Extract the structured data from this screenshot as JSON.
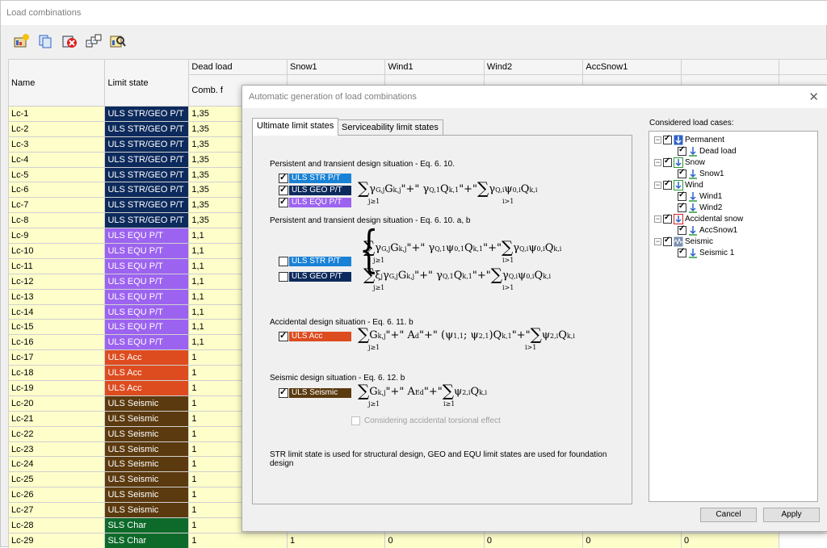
{
  "window": {
    "title": "Load combinations"
  },
  "toolbar": {
    "buttons": [
      "add-combination-icon",
      "copy-icon",
      "delete-icon",
      "generate-icon",
      "find-icon"
    ]
  },
  "table": {
    "headers": {
      "name": "Name",
      "limit_state": "Limit state",
      "dead_load": "Dead load",
      "comb_f": "Comb. f",
      "snow1": "Snow1",
      "wind1": "Wind1",
      "wind2": "Wind2",
      "accsnow1": "AccSnow1"
    },
    "rows": [
      {
        "name": "Lc-1",
        "ls": "ULS STR/GEO P/T",
        "color": "#0d2a5c",
        "f": "1,35"
      },
      {
        "name": "Lc-2",
        "ls": "ULS STR/GEO P/T",
        "color": "#0d2a5c",
        "f": "1,35"
      },
      {
        "name": "Lc-3",
        "ls": "ULS STR/GEO P/T",
        "color": "#0d2a5c",
        "f": "1,35"
      },
      {
        "name": "Lc-4",
        "ls": "ULS STR/GEO P/T",
        "color": "#0d2a5c",
        "f": "1,35"
      },
      {
        "name": "Lc-5",
        "ls": "ULS STR/GEO P/T",
        "color": "#0d2a5c",
        "f": "1,35"
      },
      {
        "name": "Lc-6",
        "ls": "ULS STR/GEO P/T",
        "color": "#0d2a5c",
        "f": "1,35"
      },
      {
        "name": "Lc-7",
        "ls": "ULS STR/GEO P/T",
        "color": "#0d2a5c",
        "f": "1,35"
      },
      {
        "name": "Lc-8",
        "ls": "ULS STR/GEO P/T",
        "color": "#0d2a5c",
        "f": "1,35"
      },
      {
        "name": "Lc-9",
        "ls": "ULS EQU P/T",
        "color": "#9c63f0",
        "f": "1,1"
      },
      {
        "name": "Lc-10",
        "ls": "ULS EQU P/T",
        "color": "#9c63f0",
        "f": "1,1"
      },
      {
        "name": "Lc-11",
        "ls": "ULS EQU P/T",
        "color": "#9c63f0",
        "f": "1,1"
      },
      {
        "name": "Lc-12",
        "ls": "ULS EQU P/T",
        "color": "#9c63f0",
        "f": "1,1"
      },
      {
        "name": "Lc-13",
        "ls": "ULS EQU P/T",
        "color": "#9c63f0",
        "f": "1,1"
      },
      {
        "name": "Lc-14",
        "ls": "ULS EQU P/T",
        "color": "#9c63f0",
        "f": "1,1"
      },
      {
        "name": "Lc-15",
        "ls": "ULS EQU P/T",
        "color": "#9c63f0",
        "f": "1,1"
      },
      {
        "name": "Lc-16",
        "ls": "ULS EQU P/T",
        "color": "#9c63f0",
        "f": "1,1"
      },
      {
        "name": "Lc-17",
        "ls": "ULS Acc",
        "color": "#dd4c1f",
        "f": "1"
      },
      {
        "name": "Lc-18",
        "ls": "ULS Acc",
        "color": "#dd4c1f",
        "f": "1"
      },
      {
        "name": "Lc-19",
        "ls": "ULS Acc",
        "color": "#dd4c1f",
        "f": "1"
      },
      {
        "name": "Lc-20",
        "ls": "ULS Seismic",
        "color": "#5b3a0f",
        "f": "1"
      },
      {
        "name": "Lc-21",
        "ls": "ULS Seismic",
        "color": "#5b3a0f",
        "f": "1"
      },
      {
        "name": "Lc-22",
        "ls": "ULS Seismic",
        "color": "#5b3a0f",
        "f": "1"
      },
      {
        "name": "Lc-23",
        "ls": "ULS Seismic",
        "color": "#5b3a0f",
        "f": "1"
      },
      {
        "name": "Lc-24",
        "ls": "ULS Seismic",
        "color": "#5b3a0f",
        "f": "1"
      },
      {
        "name": "Lc-25",
        "ls": "ULS Seismic",
        "color": "#5b3a0f",
        "f": "1"
      },
      {
        "name": "Lc-26",
        "ls": "ULS Seismic",
        "color": "#5b3a0f",
        "f": "1"
      },
      {
        "name": "Lc-27",
        "ls": "ULS Seismic",
        "color": "#5b3a0f",
        "f": "1"
      },
      {
        "name": "Lc-28",
        "ls": "SLS Char",
        "color": "#0e6a2b",
        "f": "1"
      },
      {
        "name": "Lc-29",
        "ls": "SLS Char",
        "color": "#0e6a2b",
        "f": "1",
        "snow1": "1",
        "wind1": "0",
        "wind2": "0",
        "accsnow1": "0",
        "extra": "0"
      }
    ]
  },
  "dialog": {
    "title": "Automatic generation of load combinations",
    "tabs": [
      "Ultimate limit states",
      "Serviceability limit states"
    ],
    "sections": {
      "s1": "Persistent and transient design situation - Eq. 6. 10.",
      "s2": "Persistent and transient design situation - Eq. 6. 10. a, b",
      "s3": "Accidental design situation - Eq. 6. 11. b",
      "s4": "Seismic design situation - Eq. 6. 12. b"
    },
    "options": {
      "uls_str": {
        "label": "ULS STR P/T",
        "color": "#1a82d6"
      },
      "uls_geo": {
        "label": "ULS GEO P/T",
        "color": "#0d2a5c"
      },
      "uls_equ": {
        "label": "ULS EQU P/T",
        "color": "#9c63f0"
      },
      "uls_str_ab": {
        "label": "ULS STR P/T",
        "color": "#1a82d6"
      },
      "uls_geo_ab": {
        "label": "ULS GEO P/T",
        "color": "#0d2a5c"
      },
      "uls_acc": {
        "label": "ULS Acc",
        "color": "#dd4c1f"
      },
      "uls_seismic": {
        "label": "ULS Seismic",
        "color": "#5b3a0f"
      }
    },
    "torsion_label": "Considering accidental torsional effect",
    "footer_note": "STR limit state is used for structural design, GEO and EQU limit states are used for foundation design",
    "considered_label": "Considered load cases:",
    "tree": [
      {
        "group": "Permanent",
        "children": [
          "Dead load"
        ]
      },
      {
        "group": "Snow",
        "children": [
          "Snow1"
        ]
      },
      {
        "group": "Wind",
        "children": [
          "Wind1",
          "Wind2"
        ]
      },
      {
        "group": "Accidental snow",
        "children": [
          "AccSnow1"
        ]
      },
      {
        "group": "Seismic",
        "children": [
          "Seismic 1"
        ]
      }
    ],
    "cancel_label": "Cancel",
    "apply_label": "Apply"
  }
}
